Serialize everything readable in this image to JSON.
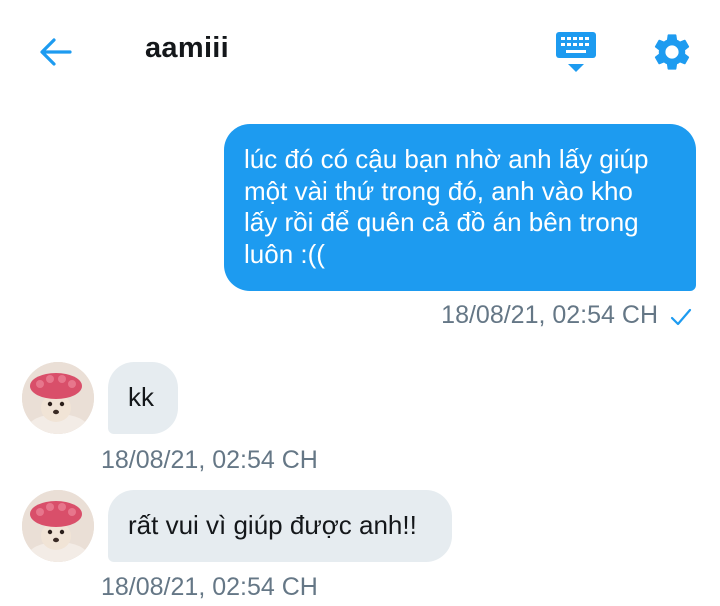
{
  "header": {
    "title": "aamiii",
    "back_icon": "arrow-left-icon",
    "keyboard_icon": "keyboard-icon",
    "settings_icon": "gear-icon"
  },
  "colors": {
    "accent": "#1d9bf0",
    "incoming_bubble": "#e6ecf0",
    "timestamp": "#657786",
    "text": "#14171a"
  },
  "messages": [
    {
      "direction": "outgoing",
      "lines": [
        "lúc đó có cậu bạn nhờ anh lấy giúp",
        "một vài thứ trong đó, anh vào kho",
        "lấy rồi để quên cả đồ án bên trong",
        "luôn :(("
      ],
      "timestamp": "18/08/21, 02:54 CH",
      "status_icon": "check-icon"
    },
    {
      "direction": "incoming",
      "text": "kk",
      "timestamp": "18/08/21, 02:54 CH"
    },
    {
      "direction": "incoming",
      "text": "rất vui vì giúp được anh!!",
      "timestamp": "18/08/21, 02:54 CH"
    }
  ]
}
